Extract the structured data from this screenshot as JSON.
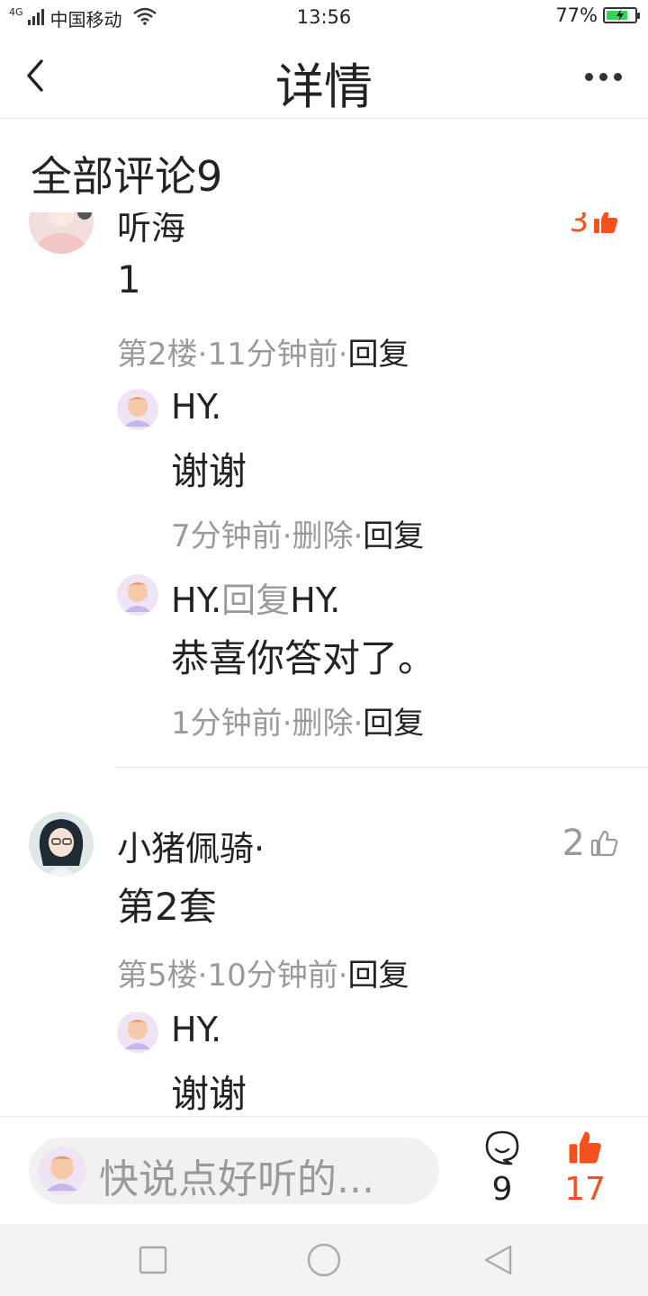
{
  "status_bar": {
    "network": "4G",
    "carrier": "中国移动",
    "time": "13:56",
    "battery_text": "77%",
    "battery_level": 0.77
  },
  "nav": {
    "title": "详情"
  },
  "section": {
    "title": "全部评论9"
  },
  "comments": [
    {
      "name": "听海",
      "likes": "3",
      "body": "1",
      "floor": "第2楼",
      "time": "11分钟前",
      "reply": "回复",
      "replies": [
        {
          "name": "HY.",
          "body": "谢谢",
          "time": "7分钟前",
          "delete": "删除",
          "reply": "回复"
        },
        {
          "name": "HY.",
          "reply_word": "回复",
          "target": "HY.",
          "body": "恭喜你答对了。",
          "time": "1分钟前",
          "delete": "删除",
          "reply": "回复"
        }
      ]
    },
    {
      "name": "小猪佩骑·",
      "likes": "2",
      "body": "第2套",
      "floor": "第5楼",
      "time": "10分钟前",
      "reply": "回复",
      "replies": [
        {
          "name": "HY.",
          "body": "谢谢"
        }
      ]
    }
  ],
  "separator": "·",
  "bottom_bar": {
    "input_placeholder": "快说点好听的...",
    "comment_count": "9",
    "like_count": "17"
  },
  "colors": {
    "accent": "#f4511e",
    "muted": "#9a9a9a",
    "text": "#222222"
  }
}
